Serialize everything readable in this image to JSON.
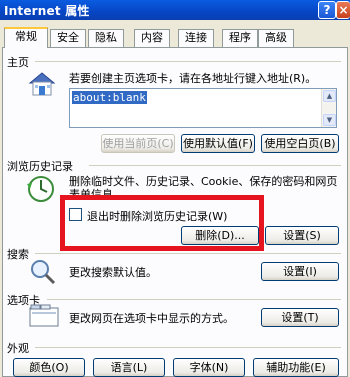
{
  "window": {
    "title": "Internet 属性",
    "help_label": "?",
    "close_label": "×"
  },
  "tabs": [
    {
      "label": "常规"
    },
    {
      "label": "安全"
    },
    {
      "label": "隐私"
    },
    {
      "label": "内容"
    },
    {
      "label": "连接"
    },
    {
      "label": "程序"
    },
    {
      "label": "高级"
    }
  ],
  "home": {
    "title": "主页",
    "description": "若要创建主页选项卡，请在各地址行键入地址(R)。",
    "value": "about:blank",
    "btn_current": "使用当前页(C)",
    "btn_default": "使用默认值(F)",
    "btn_blank": "使用空白页(B)"
  },
  "history": {
    "title": "浏览历史记录",
    "description_line1": "删除临时文件、历史记录、Cookie、保存的密码和网页",
    "description_line2": "表单信息。",
    "checkbox_label": "退出时删除浏览历史记录(W)",
    "btn_delete": "删除(D)...",
    "btn_settings": "设置(S)"
  },
  "search": {
    "title": "搜索",
    "description": "更改搜索默认值。",
    "btn_settings": "设置(I)"
  },
  "tabs_section": {
    "title": "选项卡",
    "description": "更改网页在选项卡中显示的方式。",
    "btn_settings": "设置(T)"
  },
  "appearance": {
    "title": "外观",
    "btn_colors": "颜色(O)",
    "btn_languages": "语言(L)",
    "btn_fonts": "字体(N)",
    "btn_accessibility": "辅助功能(E)"
  },
  "colors": {
    "highlight": "#e6141e",
    "titlebar": "#0645c4",
    "selection": "#316ac5"
  }
}
